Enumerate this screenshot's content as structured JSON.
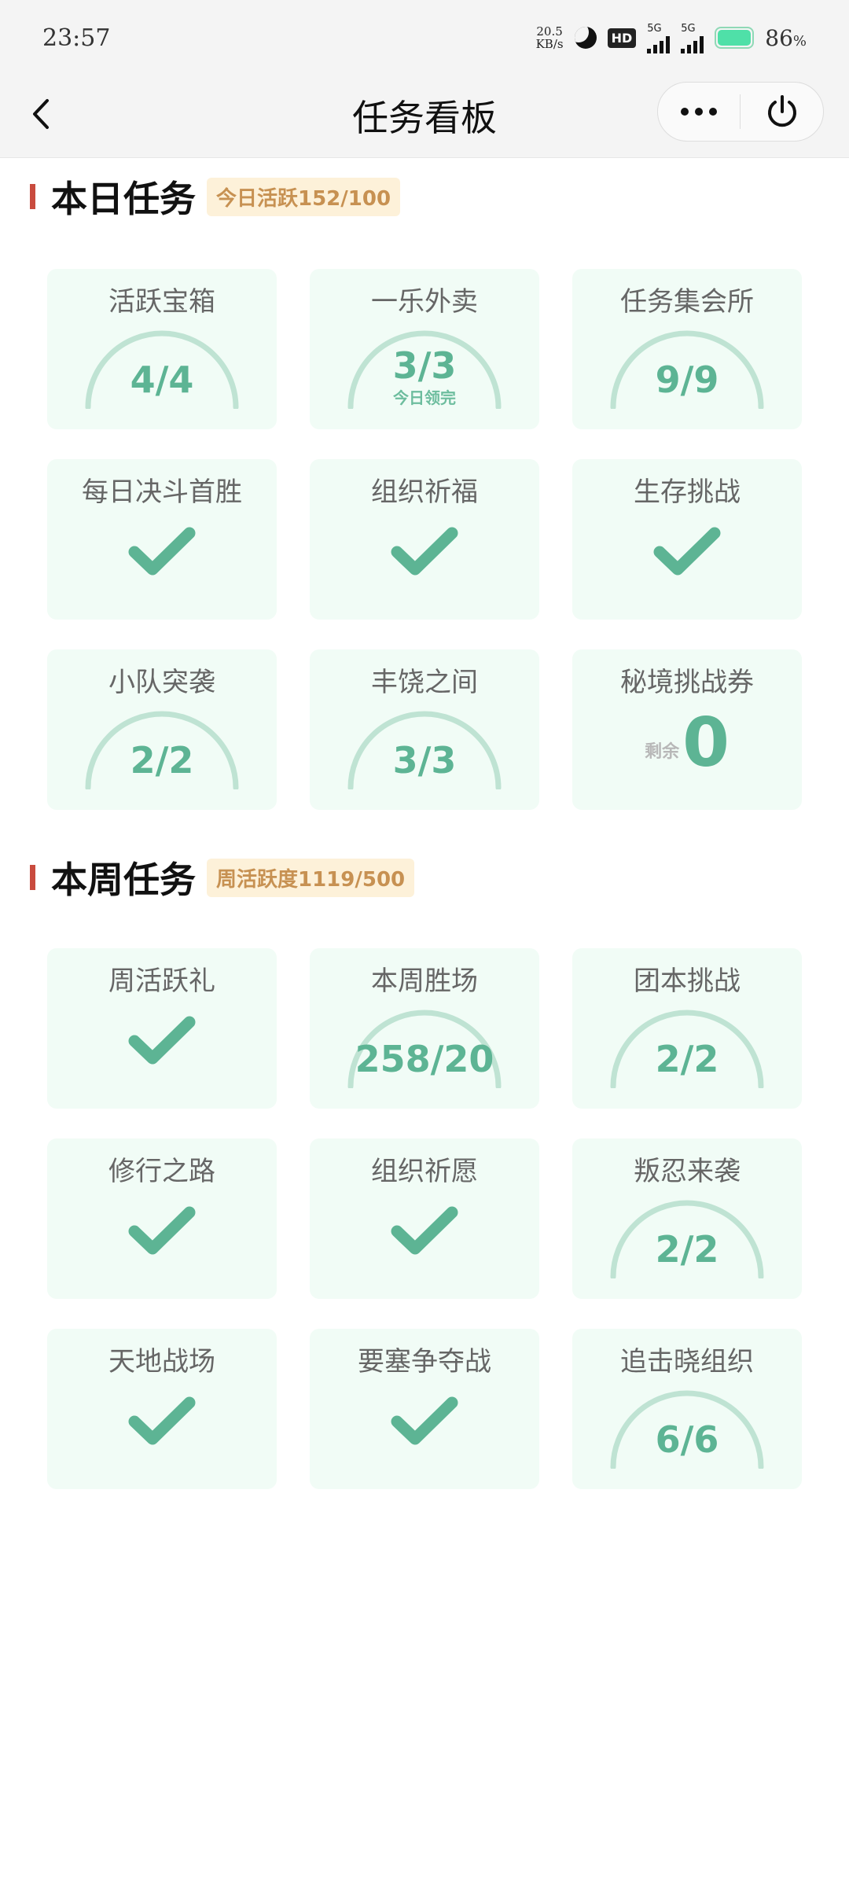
{
  "status_bar": {
    "time": "23:57",
    "speed_value": "20.5",
    "speed_unit": "KB/s",
    "hd_badge": "HD",
    "network1": "5G",
    "network2": "5G",
    "battery_value": "86",
    "battery_unit": "%"
  },
  "nav": {
    "title": "任务看板"
  },
  "daily": {
    "title": "本日任务",
    "badge": "今日活跃152/100",
    "cards": [
      {
        "title": "活跃宝箱",
        "value": "4/4"
      },
      {
        "title": "一乐外卖",
        "value": "3/3",
        "sub": "今日领完"
      },
      {
        "title": "任务集会所",
        "value": "9/9"
      },
      {
        "title": "每日决斗首胜"
      },
      {
        "title": "组织祈福"
      },
      {
        "title": "生存挑战"
      },
      {
        "title": "小队突袭",
        "value": "2/2"
      },
      {
        "title": "丰饶之间",
        "value": "3/3"
      },
      {
        "title": "秘境挑战券",
        "remain_label": "剩余",
        "remain_value": "0"
      }
    ]
  },
  "weekly": {
    "title": "本周任务",
    "badge": "周活跃度1119/500",
    "cards": [
      {
        "title": "周活跃礼"
      },
      {
        "title": "本周胜场",
        "value": "258/20"
      },
      {
        "title": "团本挑战",
        "value": "2/2"
      },
      {
        "title": "修行之路"
      },
      {
        "title": "组织祈愿"
      },
      {
        "title": "叛忍来袭",
        "value": "2/2"
      },
      {
        "title": "天地战场"
      },
      {
        "title": "要塞争夺战"
      },
      {
        "title": "追击晓组织",
        "value": "6/6"
      }
    ]
  },
  "colors": {
    "card_bg": "#f1fcf6",
    "accent_green": "#5db494",
    "gauge_arc": "#bfe3d3",
    "section_bar": "#c94b3e",
    "badge_bg": "#fdf1d9",
    "badge_text": "#c79152"
  }
}
